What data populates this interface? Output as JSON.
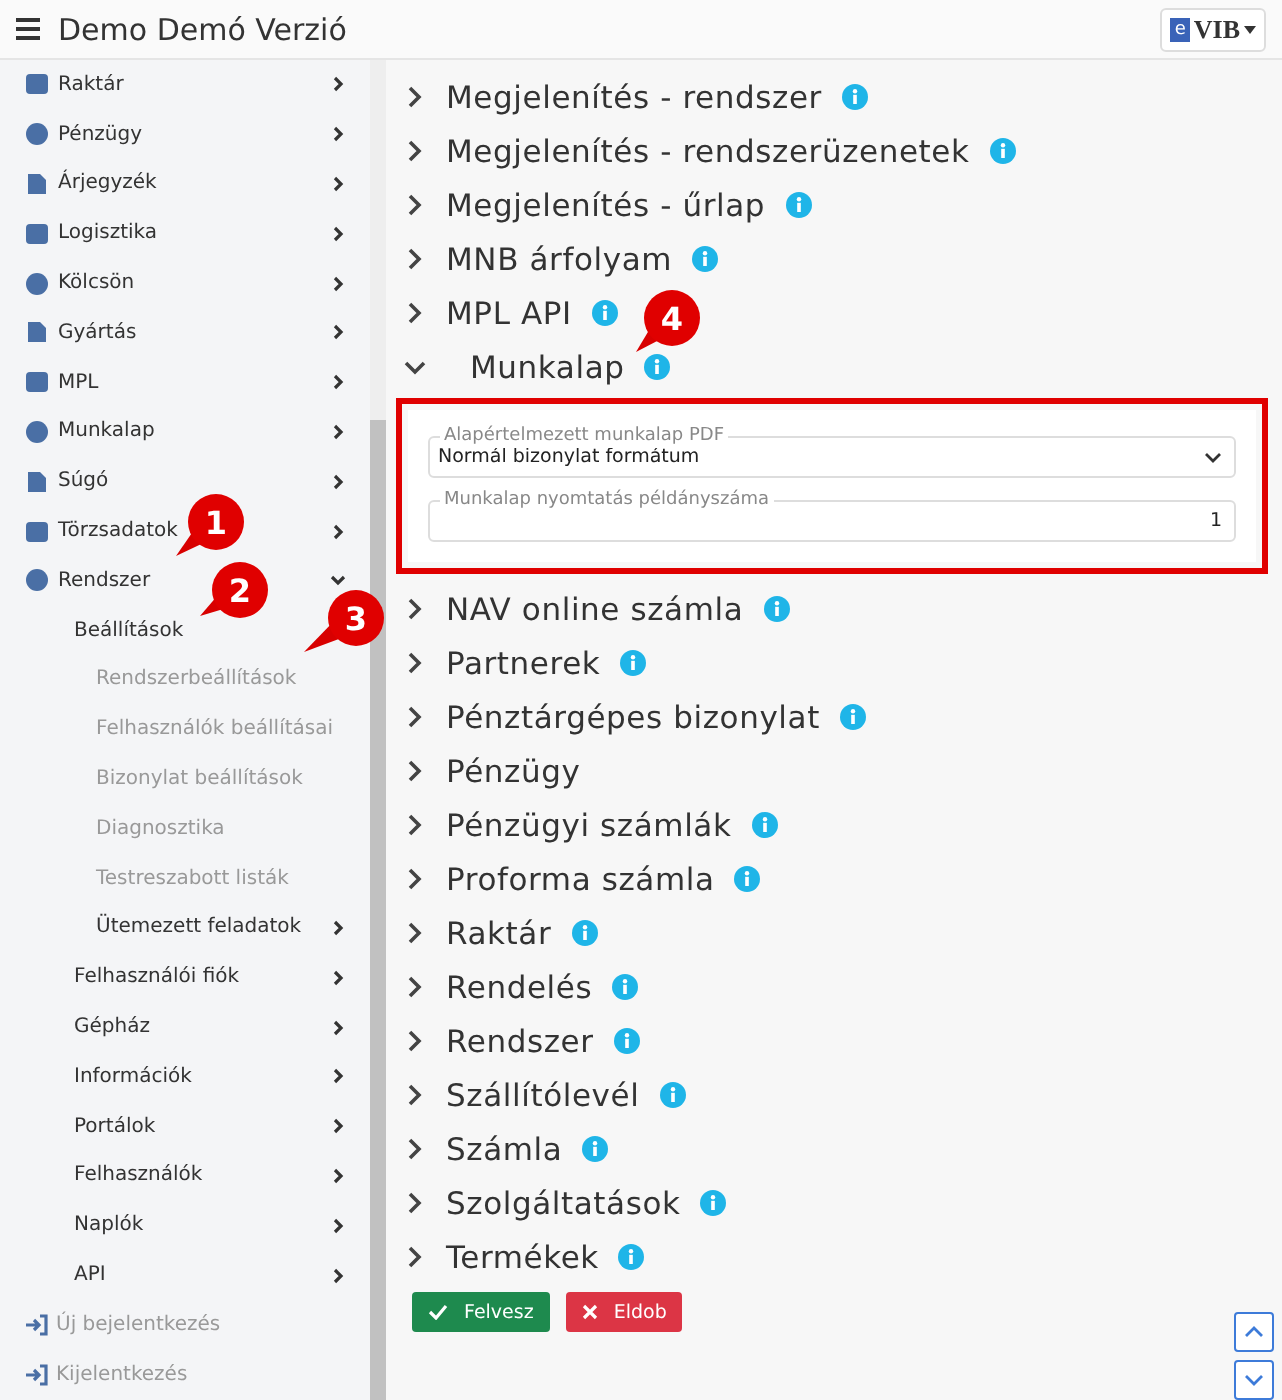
{
  "header": {
    "title": "Demo Demó Verzió",
    "logo": {
      "mark": "e",
      "name": "VIB"
    }
  },
  "sidebar": {
    "items": [
      {
        "label": "Raktár",
        "expanded": false
      },
      {
        "label": "Pénzügy",
        "expanded": false
      },
      {
        "label": "Árjegyzék",
        "expanded": false
      },
      {
        "label": "Logisztika",
        "expanded": false
      },
      {
        "label": "Kölcsön",
        "expanded": false
      },
      {
        "label": "Gyártás",
        "expanded": false
      },
      {
        "label": "MPL",
        "expanded": false
      },
      {
        "label": "Munkalap",
        "expanded": false
      },
      {
        "label": "Súgó",
        "expanded": false
      },
      {
        "label": "Törzsadatok",
        "expanded": false
      },
      {
        "label": "Rendszer",
        "expanded": true,
        "children": [
          {
            "label": "Beállítások",
            "children": [
              {
                "label": "Rendszerbeállítások"
              },
              {
                "label": "Felhasználók beállításai"
              },
              {
                "label": "Bizonylat beállítások"
              },
              {
                "label": "Diagnosztika"
              },
              {
                "label": "Testreszabott listák"
              },
              {
                "label": "Ütemezett feladatok",
                "expanded": false
              }
            ]
          },
          {
            "label": "Felhasználói fiók",
            "expanded": false
          },
          {
            "label": "Gépház",
            "expanded": false
          },
          {
            "label": "Információk",
            "expanded": false
          },
          {
            "label": "Portálok",
            "expanded": false
          },
          {
            "label": "Felhasználók",
            "expanded": false
          },
          {
            "label": "Naplók",
            "expanded": false
          },
          {
            "label": "API",
            "expanded": false
          }
        ]
      },
      {
        "label": "Új bejelentkezés"
      },
      {
        "label": "Kijelentkezés"
      }
    ]
  },
  "sections": [
    {
      "title": "Megjelenítés - rendszer",
      "info": true,
      "expanded": false
    },
    {
      "title": "Megjelenítés - rendszerüzenetek",
      "info": true,
      "expanded": false
    },
    {
      "title": "Megjelenítés - űrlap",
      "info": true,
      "expanded": false
    },
    {
      "title": "MNB árfolyam",
      "info": true,
      "expanded": false
    },
    {
      "title": "MPL API",
      "info": true,
      "expanded": false
    },
    {
      "title": "Munkalap",
      "info": true,
      "expanded": true,
      "highlighted": true,
      "fields": [
        {
          "kind": "select",
          "label": "Alapértelmezett munkalap PDF",
          "value": "Normál bizonylat formátum"
        },
        {
          "kind": "number",
          "label": "Munkalap nyomtatás példányszáma",
          "value": "1"
        }
      ]
    },
    {
      "title": "NAV online számla",
      "info": true,
      "expanded": false
    },
    {
      "title": "Partnerek",
      "info": true,
      "expanded": false
    },
    {
      "title": "Pénztárgépes bizonylat",
      "info": true,
      "expanded": false
    },
    {
      "title": "Pénzügy",
      "info": false,
      "expanded": false
    },
    {
      "title": "Pénzügyi számlák",
      "info": true,
      "expanded": false
    },
    {
      "title": "Proforma számla",
      "info": true,
      "expanded": false
    },
    {
      "title": "Raktár",
      "info": true,
      "expanded": false
    },
    {
      "title": "Rendelés",
      "info": true,
      "expanded": false
    },
    {
      "title": "Rendszer",
      "info": true,
      "expanded": false
    },
    {
      "title": "Szállítólevél",
      "info": true,
      "expanded": false
    },
    {
      "title": "Számla",
      "info": true,
      "expanded": false
    },
    {
      "title": "Szolgáltatások",
      "info": true,
      "expanded": false
    },
    {
      "title": "Termékek",
      "info": true,
      "expanded": false
    }
  ],
  "buttons": [
    {
      "kind": "save",
      "label": "Felvesz"
    },
    {
      "kind": "discard",
      "label": "Eldob"
    }
  ],
  "callouts": [
    "1",
    "2",
    "3",
    "4"
  ]
}
